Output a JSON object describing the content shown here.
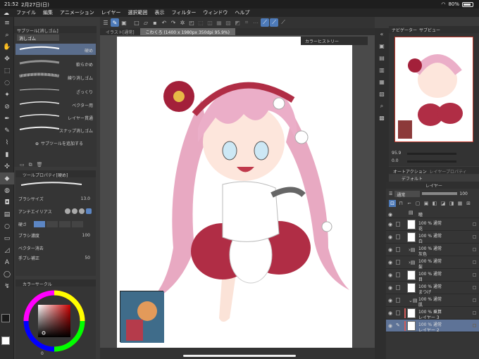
{
  "status": {
    "time": "21:52",
    "date": "2月27日(日)",
    "battery": "80%"
  },
  "menu": [
    "ファイル",
    "編集",
    "アニメーション",
    "レイヤー",
    "選択範囲",
    "表示",
    "フィルター",
    "ウィンドウ",
    "ヘルプ"
  ],
  "subtool": {
    "header": "サブツール[消しゴム]",
    "tab": "消しゴム",
    "items": [
      "硬め",
      "軟らかめ",
      "練り消しゴム",
      "ざっくり",
      "ベクター用",
      "レイヤー貫通",
      "スナップ消しゴム"
    ],
    "add": "サブツールを追加する"
  },
  "toolprop": {
    "title": "ツールプロパティ[硬め]",
    "brush_size_label": "ブラシサイズ",
    "brush_size": "13.0",
    "antialias_label": "アンチエイリアス",
    "hardness_label": "硬さ",
    "density_label": "ブラシ濃度",
    "density": "100",
    "vector_label": "ベクター消去",
    "stabilizer_label": "手ブレ補正",
    "stabilizer": "50"
  },
  "color": {
    "title": "カラーサークル",
    "ring_hue": "#ff0000",
    "square": "#8a0000",
    "value_label": "0",
    "fg": "#1a1a1a",
    "bg": "#ffffff"
  },
  "doc": {
    "tab_inactive": "イラスト[通常]",
    "tab_active": "こわくろ (1400 x 1980px 350dpi 95.9%)",
    "color_history": "カラーヒストリー"
  },
  "navigator": {
    "title": "ナビゲーター",
    "title2": "サブビュー",
    "zoom": "95.9",
    "rotate": "0.0"
  },
  "autoaction": {
    "title": "オートアクション",
    "title2": "レイヤープロパティ",
    "default": "デフォルト"
  },
  "layers": {
    "title": "レイヤー",
    "blend": "通常",
    "opacity": "100",
    "rows": [
      {
        "mode": "",
        "name": "瞳",
        "type": "folder"
      },
      {
        "mode": "100 % 通常",
        "name": "花",
        "type": "layer"
      },
      {
        "mode": "100 % 通常",
        "name": "白",
        "type": "layer"
      },
      {
        "mode": "100 % 通常",
        "name": "灰色",
        "type": "folder"
      },
      {
        "mode": "100 % 通常",
        "name": "髪",
        "type": "folder"
      },
      {
        "mode": "100 % 通常",
        "name": "目",
        "type": "layer"
      },
      {
        "mode": "100 % 通常",
        "name": "まつげ",
        "type": "layer"
      },
      {
        "mode": "100 % 通常",
        "name": "肌",
        "type": "folder"
      },
      {
        "mode": "100 % 乗算",
        "name": "レイヤー 3",
        "type": "clip"
      },
      {
        "mode": "100 % 通常",
        "name": "レイヤー 2",
        "type": "selected"
      }
    ]
  }
}
